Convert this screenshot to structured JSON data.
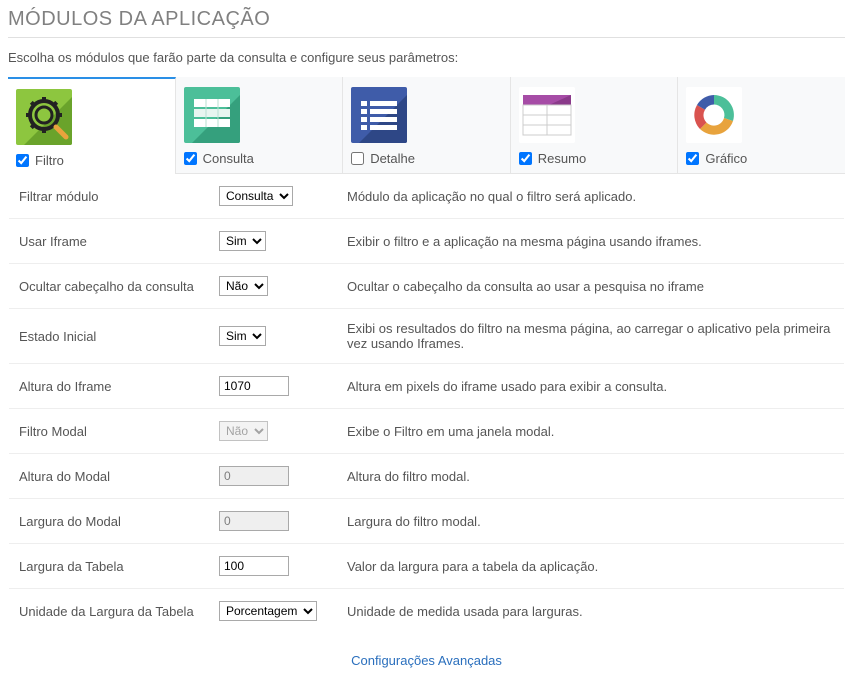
{
  "page": {
    "title": "MÓDULOS DA APLICAÇÃO",
    "subtitle": "Escolha os módulos que farão parte da consulta e configure seus parâmetros:"
  },
  "modules": {
    "filtro": {
      "label": "Filtro",
      "checked": true,
      "color": "#8dc63f"
    },
    "consulta": {
      "label": "Consulta",
      "checked": true,
      "color": "#4cbf99"
    },
    "detalhe": {
      "label": "Detalhe",
      "checked": false,
      "color": "#3f5ca9"
    },
    "resumo": {
      "label": "Resumo",
      "checked": true,
      "color": "#a64ca6"
    },
    "grafico": {
      "label": "Gráfico",
      "checked": true
    }
  },
  "options": {
    "consulta": "Consulta",
    "sim": "Sim",
    "nao": "Não",
    "porcentagem": "Porcentagem"
  },
  "rows": {
    "filtrar_modulo": {
      "label": "Filtrar módulo",
      "value": "Consulta",
      "desc": "Módulo da aplicação no qual o filtro será aplicado."
    },
    "usar_iframe": {
      "label": "Usar Iframe",
      "value": "Sim",
      "desc": "Exibir o filtro e a aplicação na mesma página usando iframes."
    },
    "ocultar_cab": {
      "label": "Ocultar cabeçalho da consulta",
      "value": "Não",
      "desc": "Ocultar o cabeçalho da consulta ao usar a pesquisa no iframe"
    },
    "estado_inicial": {
      "label": "Estado Inicial",
      "value": "Sim",
      "desc": "Exibi os resultados do filtro na mesma página, ao carregar o aplicativo pela primeira vez usando Iframes."
    },
    "altura_iframe": {
      "label": "Altura do Iframe",
      "value": "1070",
      "desc": "Altura em pixels do iframe usado para exibir a consulta."
    },
    "filtro_modal": {
      "label": "Filtro Modal",
      "value": "Não",
      "desc": "Exibe o Filtro em uma janela modal."
    },
    "altura_modal": {
      "label": "Altura do Modal",
      "value": "0",
      "desc": "Altura do filtro modal."
    },
    "largura_modal": {
      "label": "Largura do Modal",
      "value": "0",
      "desc": "Largura do filtro modal."
    },
    "largura_tabela": {
      "label": "Largura da Tabela",
      "value": "100",
      "desc": "Valor da largura para a tabela da aplicação."
    },
    "unidade_largura": {
      "label": "Unidade da Largura da Tabela",
      "value": "Porcentagem",
      "desc": "Unidade de medida usada para larguras."
    }
  },
  "advanced": {
    "label": "Configurações Avançadas"
  }
}
